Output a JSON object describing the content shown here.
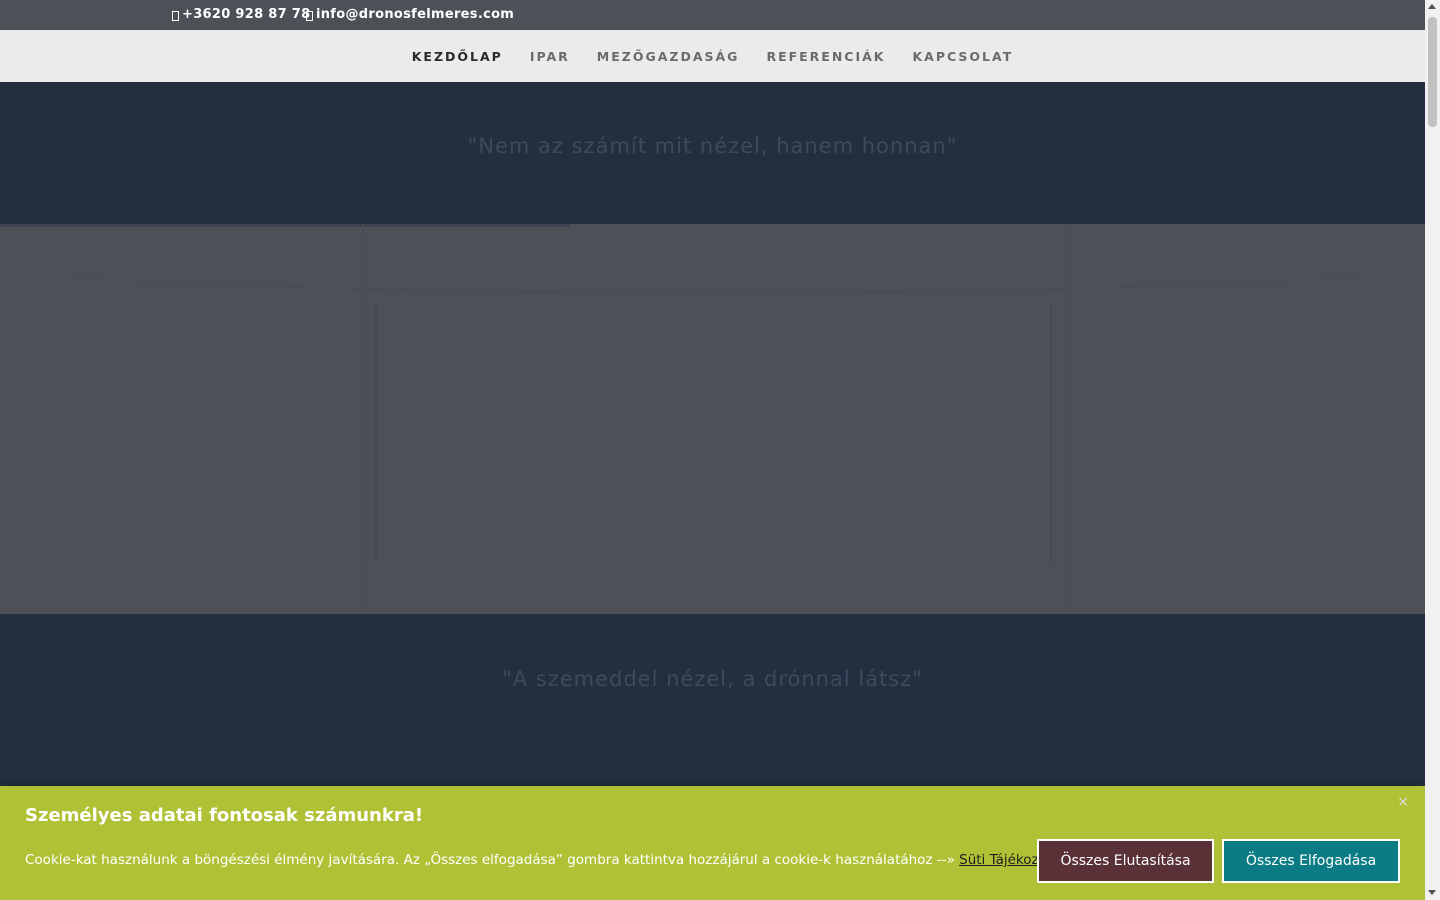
{
  "topbar": {
    "phone": "+3620 928 87 78",
    "email": "info@dronosfelmeres.com"
  },
  "nav": {
    "items": [
      "KEZDŐLAP",
      "IPAR",
      "MEZŐGAZDASÁG",
      "REFERENCIÁK",
      "KAPCSOLAT"
    ],
    "active": "KEZDŐLAP"
  },
  "quotes": {
    "top": "\"Nem az számít mit nézel, hanem honnan\"",
    "bottom": "\"A szemeddel nézel, a drónnal látsz\""
  },
  "cookie": {
    "title": "Személyes adatai fontosak számunkra!",
    "text": "Cookie-kat használunk a böngészési élmény javítására. Az „Összes elfogadása” gombra kattintva hozzájárul a cookie-k használatához --»",
    "link": "Süti Tájékoztató",
    "reject_label": "Összes Elutasítása",
    "accept_label": "Összes Elfogadása",
    "close_label": "×"
  },
  "colors": {
    "topbar": "#4c5057",
    "nav": "#ebebeb",
    "band": "#232f41",
    "cookie": "#afc236",
    "reject": "#5a3137",
    "accept": "#0b7c83"
  }
}
